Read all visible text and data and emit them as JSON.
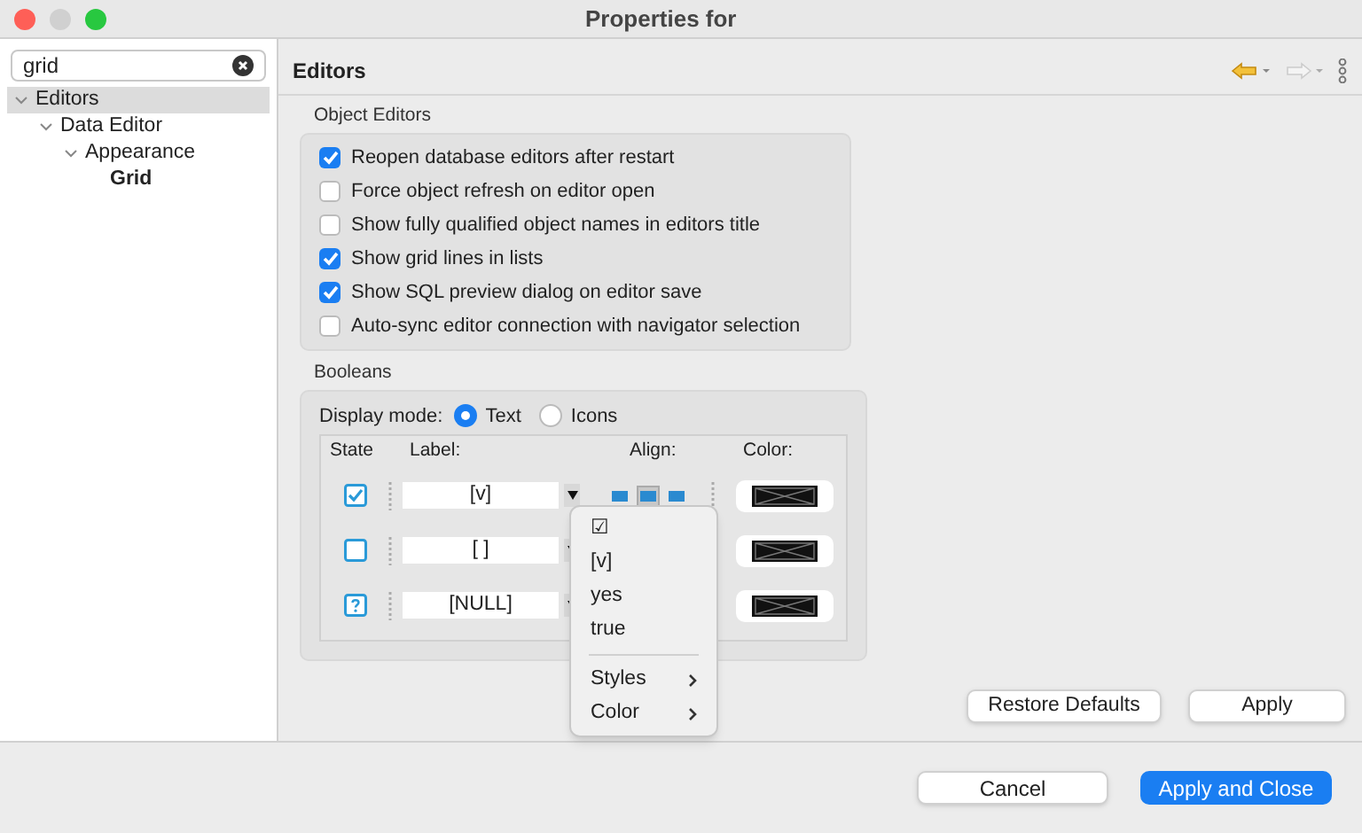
{
  "window": {
    "title": "Properties for"
  },
  "search": {
    "value": "grid"
  },
  "tree": [
    {
      "label": "Editors",
      "expanded": true,
      "selected": true,
      "children": [
        {
          "label": "Data Editor",
          "expanded": true,
          "selected": false,
          "children": [
            {
              "label": "Appearance",
              "expanded": true,
              "selected": false,
              "children": [
                {
                  "label": "Grid",
                  "selected": false,
                  "bold": true
                }
              ]
            }
          ]
        }
      ]
    }
  ],
  "page": {
    "title": "Editors"
  },
  "object_editors": {
    "title": "Object Editors",
    "options": [
      {
        "label": "Reopen database editors after restart",
        "checked": true
      },
      {
        "label": "Force object refresh on editor open",
        "checked": false
      },
      {
        "label": "Show fully qualified object names in editors title",
        "checked": false
      },
      {
        "label": "Show grid lines in lists",
        "checked": true
      },
      {
        "label": "Show SQL preview dialog on editor save",
        "checked": true
      },
      {
        "label": "Auto-sync editor connection with navigator selection",
        "checked": false
      }
    ]
  },
  "booleans": {
    "title": "Booleans",
    "display_mode_label": "Display mode:",
    "modes": [
      {
        "label": "Text",
        "selected": true
      },
      {
        "label": "Icons",
        "selected": false
      }
    ],
    "columns": [
      "State",
      "Label:",
      "Align:",
      "Color:"
    ],
    "rows": [
      {
        "kind": "checked",
        "label": "[v]",
        "align": [
          {
            "selected": false
          },
          {
            "selected": true
          },
          {
            "selected": false
          }
        ]
      },
      {
        "kind": "unchecked",
        "label": "[ ]"
      },
      {
        "kind": "null",
        "label": "[NULL]"
      }
    ]
  },
  "menu": {
    "items": [
      {
        "kind": "item",
        "label": "☑"
      },
      {
        "kind": "item",
        "label": "[v]"
      },
      {
        "kind": "item",
        "label": "yes"
      },
      {
        "kind": "item",
        "label": "true"
      },
      {
        "kind": "separator"
      },
      {
        "kind": "submenu",
        "label": "Styles"
      },
      {
        "kind": "submenu",
        "label": "Color"
      }
    ]
  },
  "page_buttons": [
    "Restore Defaults",
    "Apply"
  ],
  "dialog_buttons": [
    {
      "label": "Cancel",
      "primary": false
    },
    {
      "label": "Apply and Close",
      "primary": true
    }
  ]
}
